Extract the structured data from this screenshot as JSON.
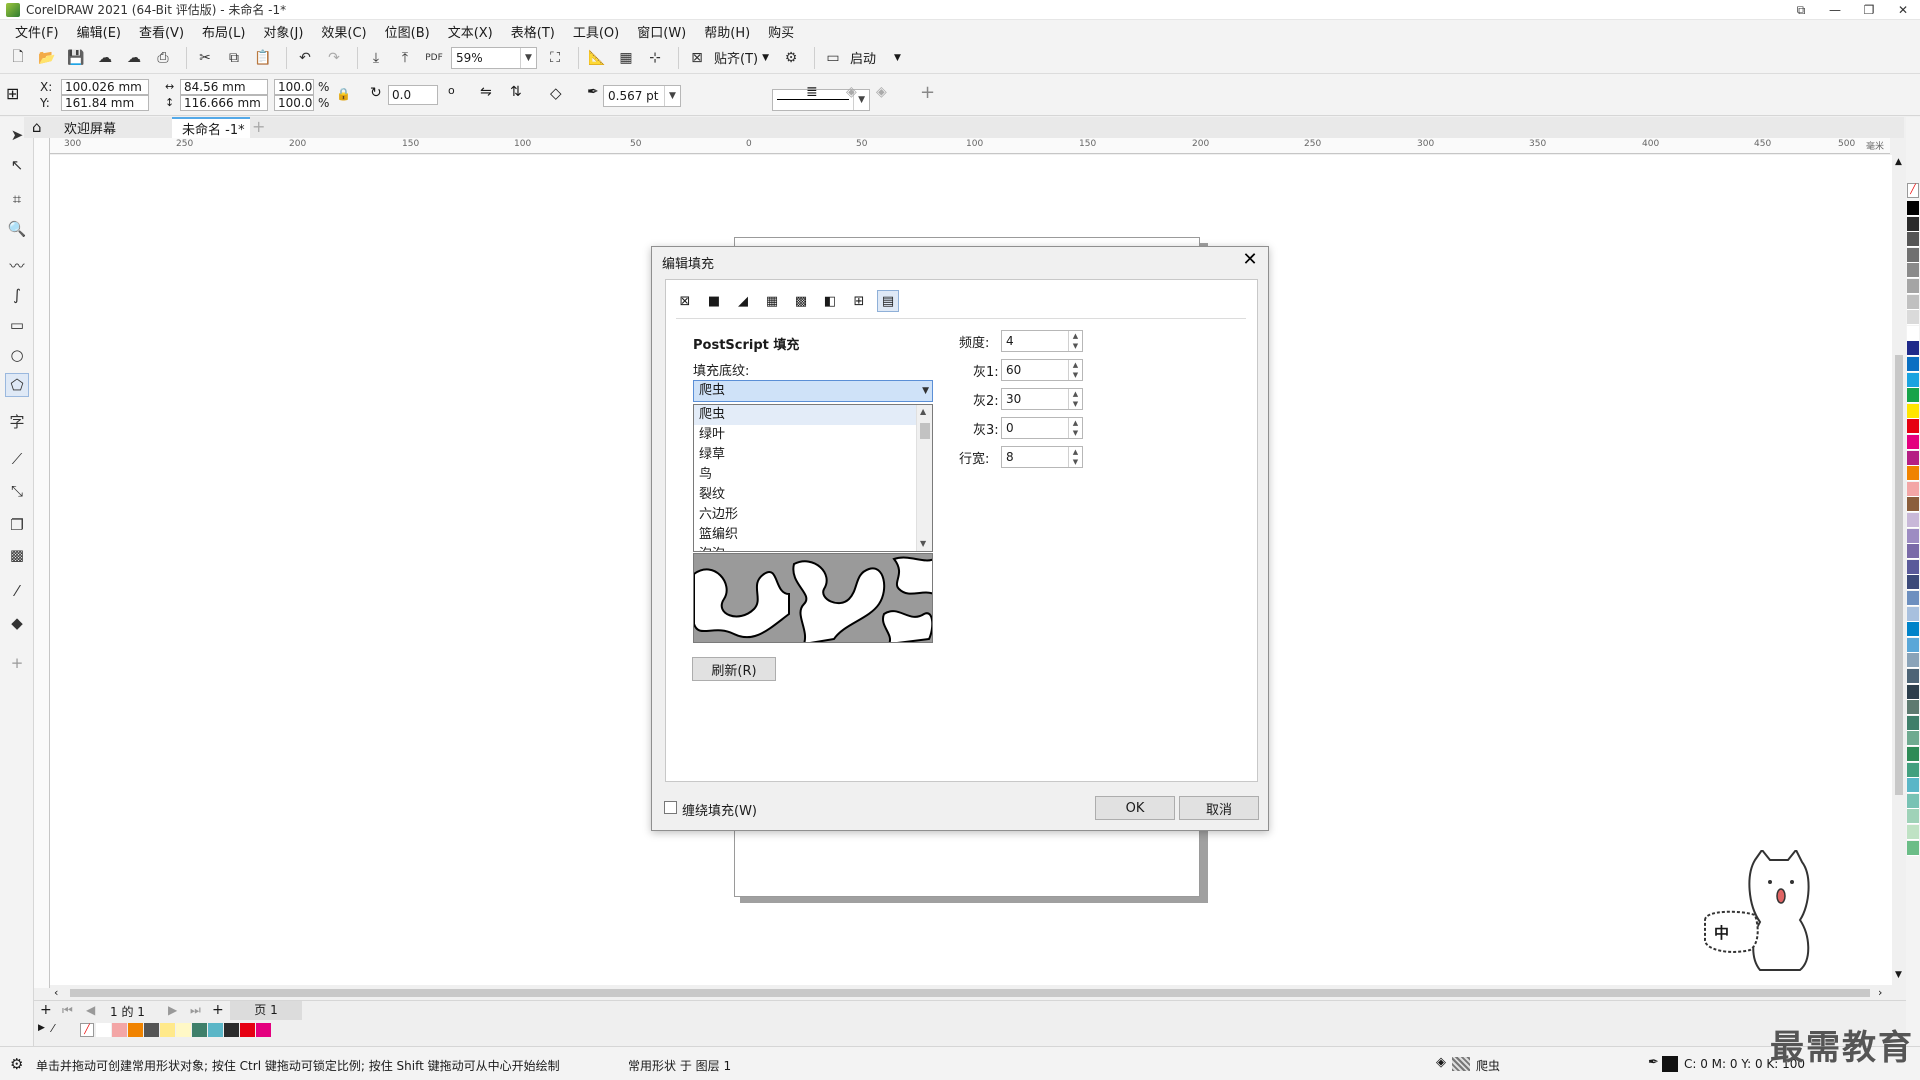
{
  "window": {
    "title": "CorelDRAW 2021 (64-Bit 评估版) - 未命名 -1*"
  },
  "menu": {
    "items": [
      "文件(F)",
      "编辑(E)",
      "查看(V)",
      "布局(L)",
      "对象(J)",
      "效果(C)",
      "位图(B)",
      "文本(X)",
      "表格(T)",
      "工具(O)",
      "窗口(W)",
      "帮助(H)",
      "购买"
    ]
  },
  "toolbar": {
    "zoom": "59%",
    "snap_label": "贴齐(T)",
    "launch_label": "启动"
  },
  "propbar": {
    "x_label": "X:",
    "x_value": "100.026 mm",
    "y_label": "Y:",
    "y_value": "161.84 mm",
    "w_value": "84.56 mm",
    "h_value": "116.666 mm",
    "scale_w": "100.0",
    "scale_h": "100.0",
    "percent": "%",
    "rotation": "0.0",
    "outline_width": "0.567 pt"
  },
  "tabs": {
    "welcome": "欢迎屏幕",
    "document": "未命名 -1*"
  },
  "rulers": {
    "h_ticks": [
      "300",
      "250",
      "200",
      "150",
      "100",
      "50",
      "0",
      "50",
      "100",
      "150",
      "200",
      "250",
      "300",
      "350",
      "400",
      "450",
      "500"
    ],
    "h_unit": "毫米"
  },
  "dialog": {
    "title": "编辑填充",
    "section_title": "PostScript 填充",
    "pattern_label": "填充底纹:",
    "selected_pattern": "爬虫",
    "patterns": [
      "爬虫",
      "绿叶",
      "绿草",
      "鸟",
      "裂纹",
      "六边形",
      "篮编织",
      "泡泡"
    ],
    "refresh_label": "刷新(R)",
    "params": [
      {
        "label": "频度:",
        "value": "4"
      },
      {
        "label": "灰1:",
        "value": "60"
      },
      {
        "label": "灰2:",
        "value": "30"
      },
      {
        "label": "灰3:",
        "value": "0"
      },
      {
        "label": "行宽:",
        "value": "8"
      }
    ],
    "wrap_fill_label": "缠绕填充(W)",
    "ok_label": "OK",
    "cancel_label": "取消"
  },
  "pagenav": {
    "page_info": "1 的 1",
    "page_tab": "页 1"
  },
  "status": {
    "hint": "单击并拖动可创建常用形状对象; 按住 Ctrl 键拖动可锁定比例; 按住 Shift 键拖动可从中心开始绘制",
    "object_info": "常用形状 于 图层 1",
    "fill_name": "爬虫",
    "color_readout": "C: 0 M: 0 Y: 0 K: 100"
  },
  "mascot": {
    "badge_text": "中"
  },
  "watermark": "最需教育",
  "palette": {
    "colors": [
      "#000000",
      "#2b2b2b",
      "#555555",
      "#707070",
      "#8a8a8a",
      "#a5a5a5",
      "#c0c0c0",
      "#dadada",
      "#ffffff",
      "#1f2a8a",
      "#0a6fc2",
      "#1aa3e0",
      "#17a34a",
      "#ffe500",
      "#e60012",
      "#e4007f",
      "#b51f84",
      "#f08300",
      "#f3a6a6",
      "#8b5e3c",
      "#c8b8d8",
      "#9d8cc2",
      "#7a6aa8",
      "#5a5a9a",
      "#3c4a7a",
      "#6d8fbf",
      "#a8c0de",
      "#0083c9",
      "#5aa7d8",
      "#8aa3b8",
      "#4d6476",
      "#2c3e4c",
      "#5e7a70",
      "#3f7f6a",
      "#6faa90",
      "#2e8b57",
      "#43a07f",
      "#5ab6c7",
      "#78c2b4",
      "#9fd2b8",
      "#bfe2c4",
      "#6bbd87"
    ],
    "doc_colors": [
      "#ffffff",
      "#f3a6a6",
      "#f08300",
      "#555555",
      "#ffe98a",
      "#fff8c6",
      "#3f7f6a",
      "#5ab6c7",
      "#2b2b2b",
      "#e60012",
      "#e4007f"
    ]
  }
}
